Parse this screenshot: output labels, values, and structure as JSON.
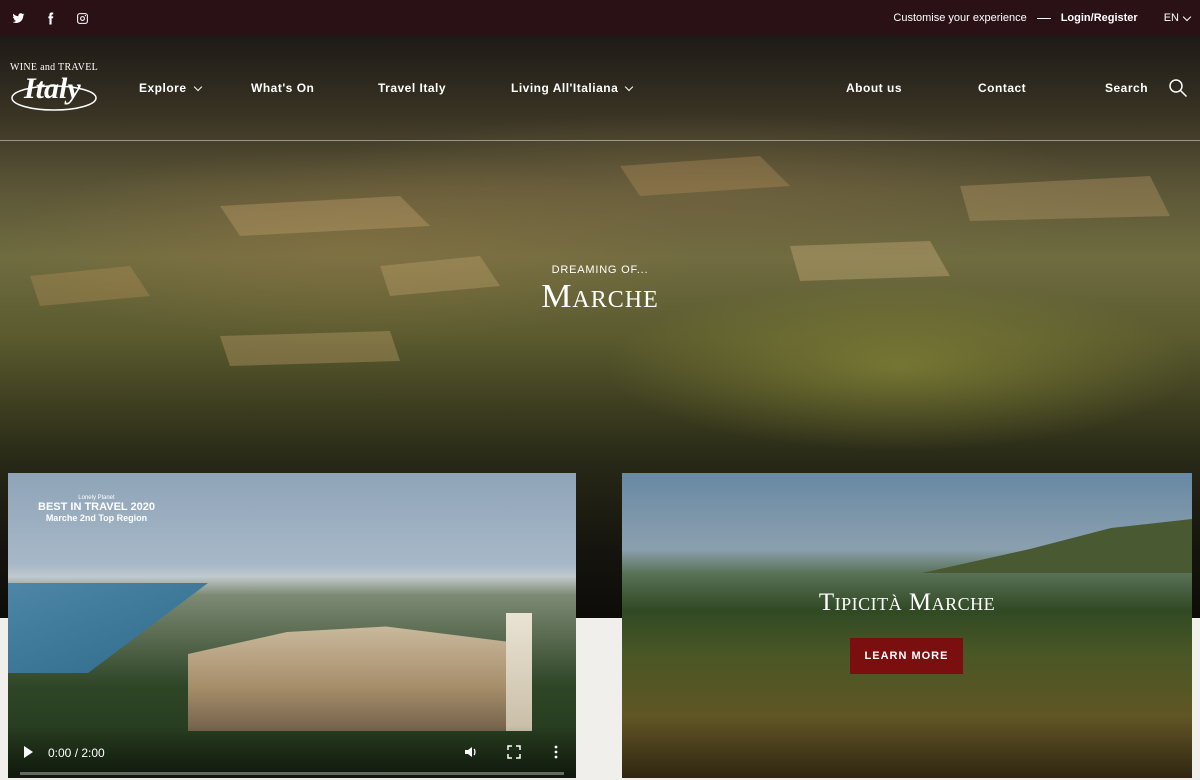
{
  "topbar": {
    "social_icons": [
      "twitter-icon",
      "facebook-icon",
      "instagram-icon"
    ],
    "customise": "Customise your experience",
    "login": "Login/Register",
    "language": "EN"
  },
  "logo": {
    "small": "WINE and TRAVEL",
    "big": "Italy"
  },
  "nav": {
    "items": [
      {
        "label": "Explore",
        "dropdown": true
      },
      {
        "label": "What's On",
        "dropdown": false
      },
      {
        "label": "Travel Italy",
        "dropdown": false
      },
      {
        "label": "Living All'Italiana",
        "dropdown": true
      },
      {
        "label": "About us",
        "dropdown": false
      },
      {
        "label": "Contact",
        "dropdown": false
      },
      {
        "label": "Search",
        "dropdown": false
      }
    ]
  },
  "hero": {
    "kicker": "DREAMING OF...",
    "title": "Marche"
  },
  "video": {
    "badge_lp": "Lonely Planet",
    "badge_best": "BEST IN TRAVEL 2020",
    "badge_region": "Marche 2nd Top Region",
    "time": "0:00 / 2:00"
  },
  "promo": {
    "title": "Tipicità Marche",
    "button": "LEARN MORE"
  },
  "colors": {
    "topbar": "#2a1116",
    "button": "#7b0f0f"
  }
}
